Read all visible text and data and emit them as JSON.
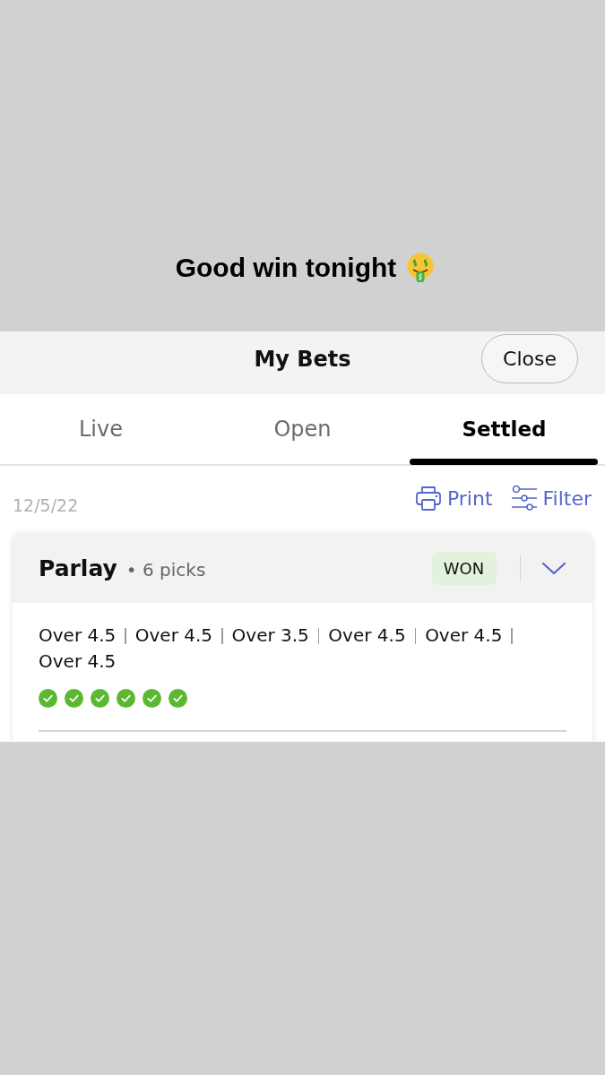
{
  "caption": {
    "text": "Good win tonight"
  },
  "header": {
    "title": "My Bets",
    "close_button": "Close"
  },
  "tabs": [
    {
      "label": "Live",
      "selected": false
    },
    {
      "label": "Open",
      "selected": false
    },
    {
      "label": "Settled",
      "selected": true
    }
  ],
  "toolbar": {
    "date": "12/5/22",
    "actions": [
      {
        "label": "Print",
        "kind": "print"
      },
      {
        "label": "Filter",
        "kind": "filter"
      }
    ]
  },
  "bet": {
    "type": "Parlay",
    "picks_count": "• 6 picks",
    "status": {
      "label": "WON",
      "kind": "won"
    },
    "picks": [
      {
        "label": "Over 4.5",
        "won": true
      },
      {
        "label": "Over 4.5",
        "won": true
      },
      {
        "label": "Over 3.5",
        "won": true
      },
      {
        "label": "Over 4.5",
        "won": true
      },
      {
        "label": "Over 4.5",
        "won": true
      },
      {
        "label": "Over 4.5",
        "won": true
      }
    ]
  }
}
